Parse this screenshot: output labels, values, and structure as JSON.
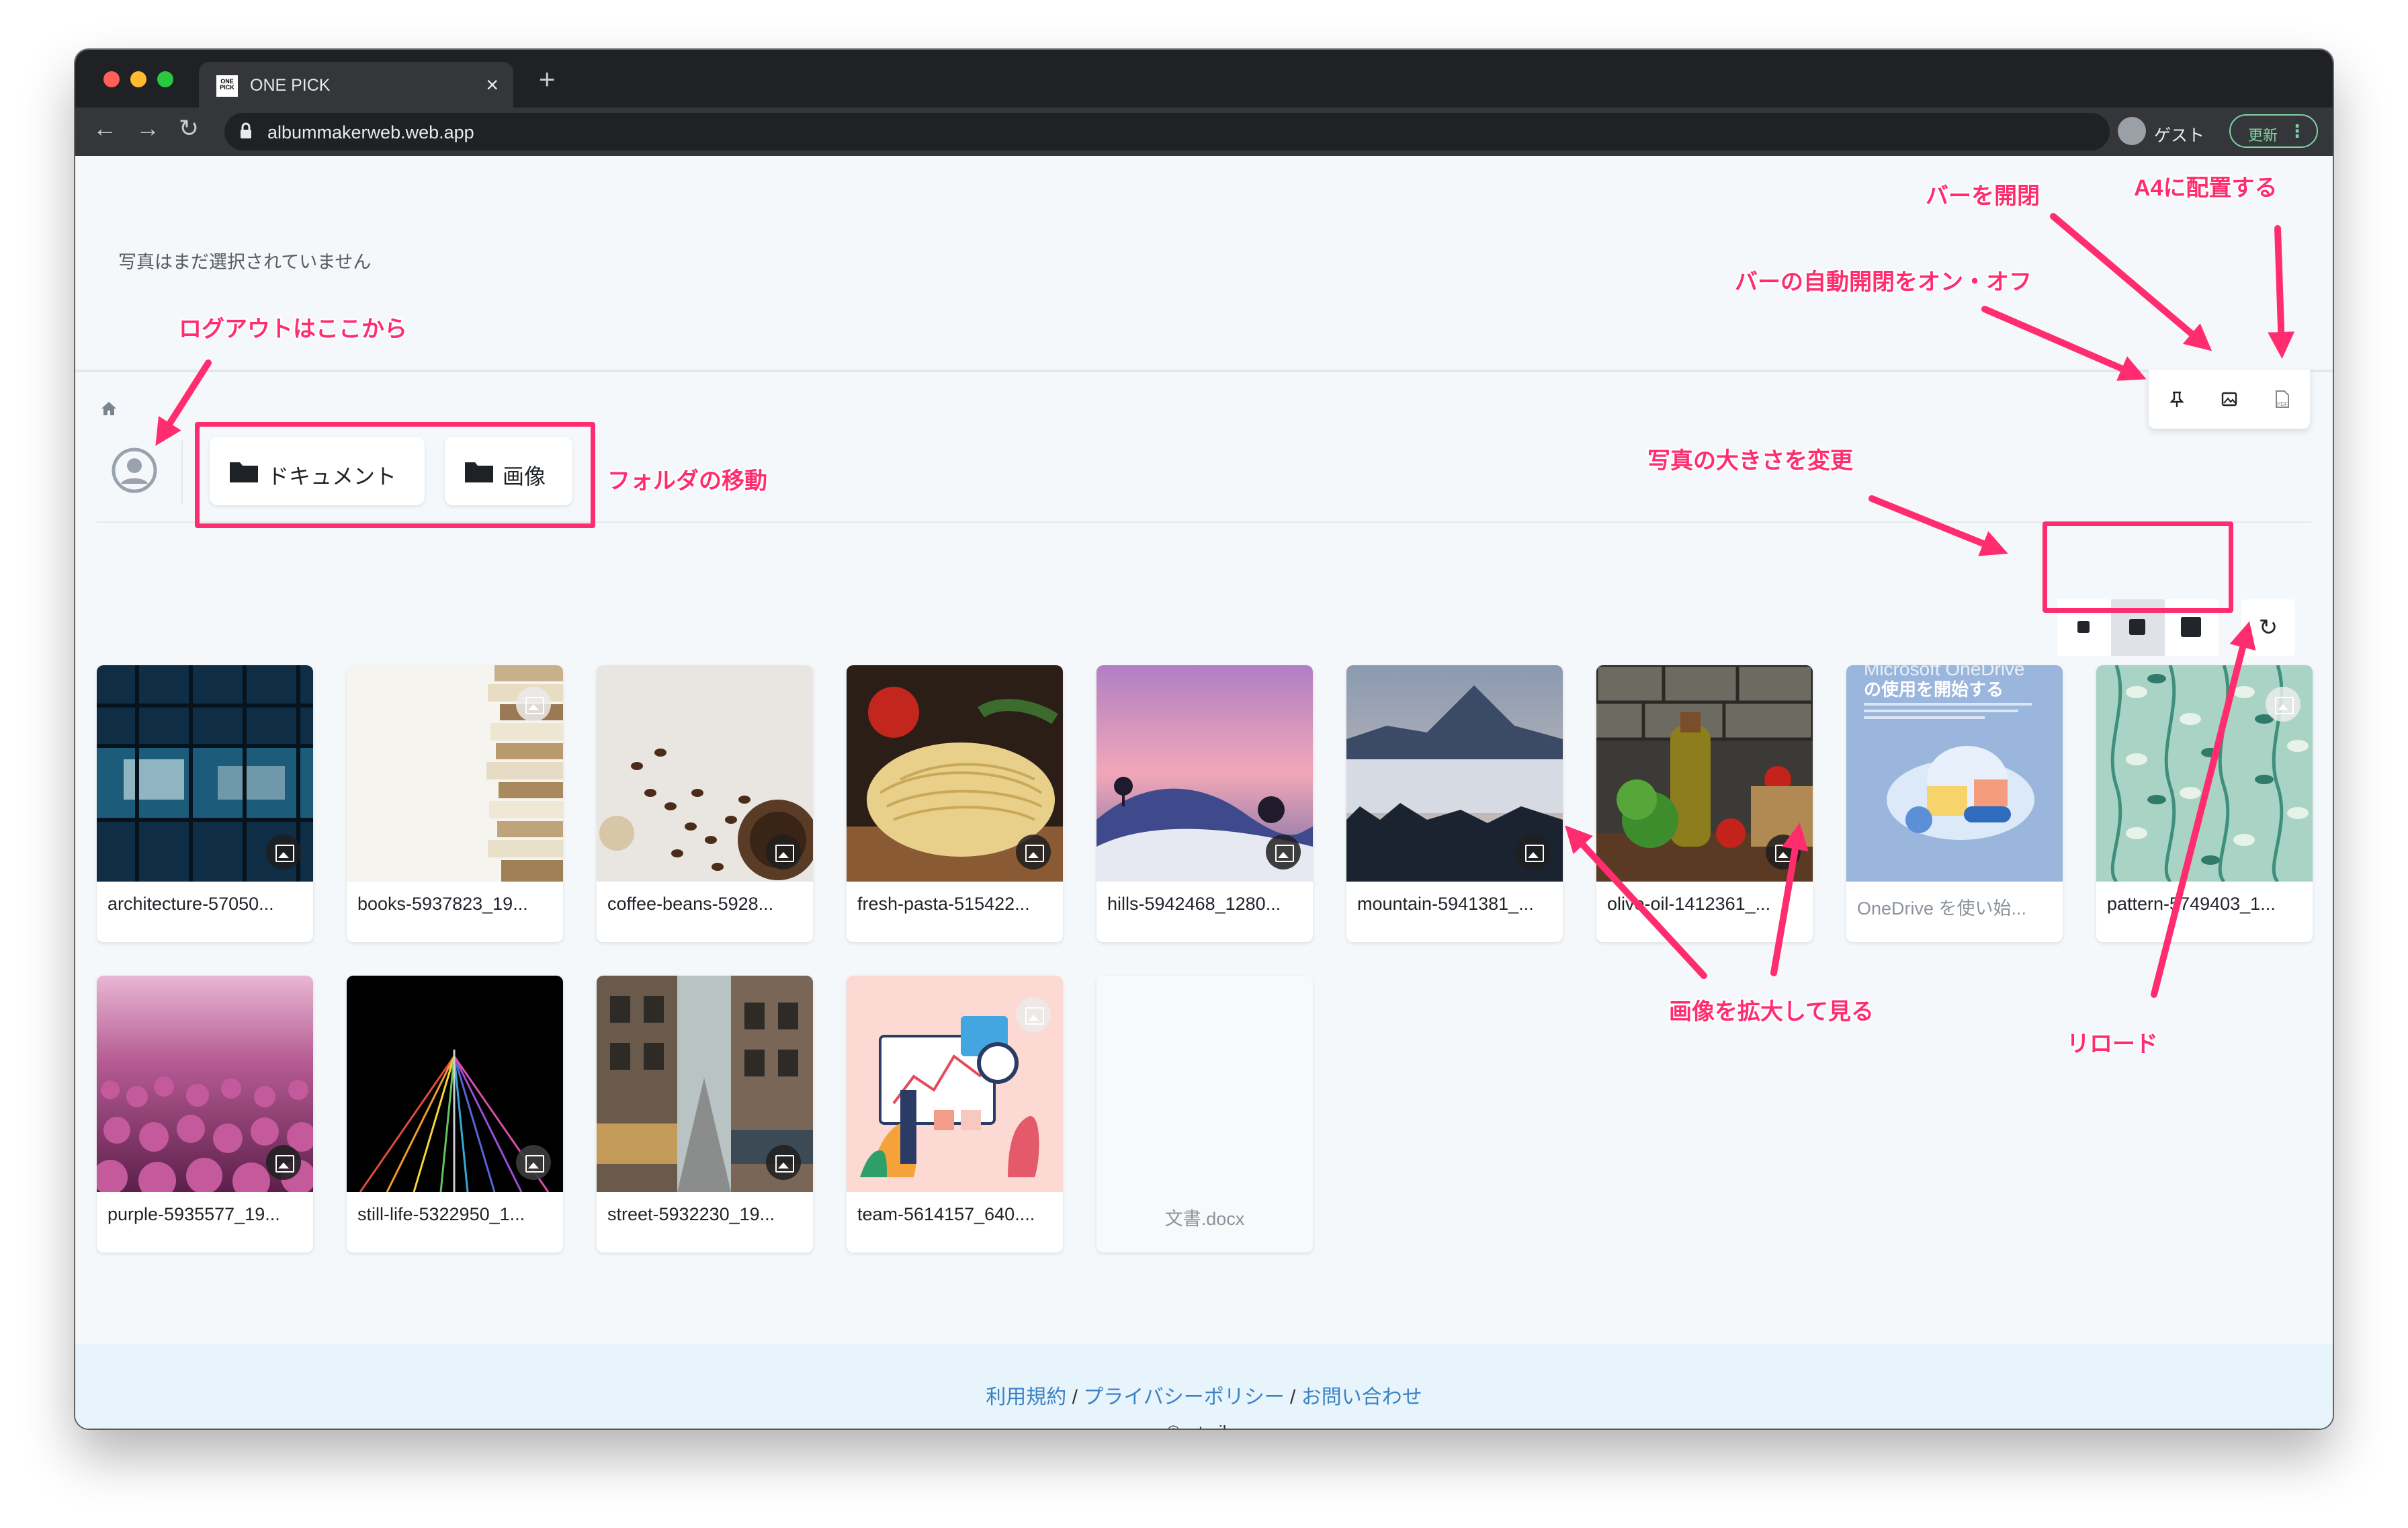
{
  "browser": {
    "tab_title": "ONE PICK",
    "tab_favicon_text": "ONE PICK",
    "url": "albummakerweb.web.app",
    "profile_label": "ゲスト",
    "update_label": "更新"
  },
  "page": {
    "status_text": "写真はまだ選択されていません",
    "tool_icons": [
      "pin-icon",
      "image-icon",
      "pdf-icon"
    ],
    "folders": [
      {
        "label": "ドキュメント"
      },
      {
        "label": "画像"
      }
    ],
    "size_buttons": [
      "small",
      "medium",
      "large"
    ],
    "active_size": "medium"
  },
  "files": [
    {
      "name": "architecture-57050...",
      "kind": "image"
    },
    {
      "name": "books-5937823_19...",
      "kind": "image"
    },
    {
      "name": "coffee-beans-5928...",
      "kind": "image"
    },
    {
      "name": "fresh-pasta-515422...",
      "kind": "image"
    },
    {
      "name": "hills-5942468_1280...",
      "kind": "image"
    },
    {
      "name": "mountain-5941381_...",
      "kind": "image"
    },
    {
      "name": "olive-oil-1412361_...",
      "kind": "image"
    },
    {
      "name": "OneDrive を使い始...",
      "kind": "onedrive",
      "thumb_title": "の使用を開始する",
      "thumb_header": "Microsoft OneDrive"
    },
    {
      "name": "pattern-5749403_1...",
      "kind": "image"
    },
    {
      "name": "purple-5935577_19...",
      "kind": "image"
    },
    {
      "name": "still-life-5322950_1...",
      "kind": "image"
    },
    {
      "name": "street-5932230_19...",
      "kind": "image"
    },
    {
      "name": "team-5614157_640....",
      "kind": "image"
    },
    {
      "name": "文書.docx",
      "kind": "document"
    }
  ],
  "footer": {
    "terms": "利用規約",
    "privacy": "プライバシーポリシー",
    "contact": "お問い合わせ",
    "separator": "/",
    "copyright": "©yuta-ike"
  },
  "annotations": {
    "logout": "ログアウトはここから",
    "folder_move": "フォルダの移動",
    "bar_open": "バーを開閉",
    "a4": "A4に配置する",
    "auto_bar": "バーの自動開閉をオン・オフ",
    "photo_size": "写真の大きさを変更",
    "zoom": "画像を拡大して見る",
    "reload": "リロード"
  },
  "colors": {
    "accent": "#ff2d6f",
    "link": "#3a82c4",
    "chrome_dark": "#202124"
  }
}
